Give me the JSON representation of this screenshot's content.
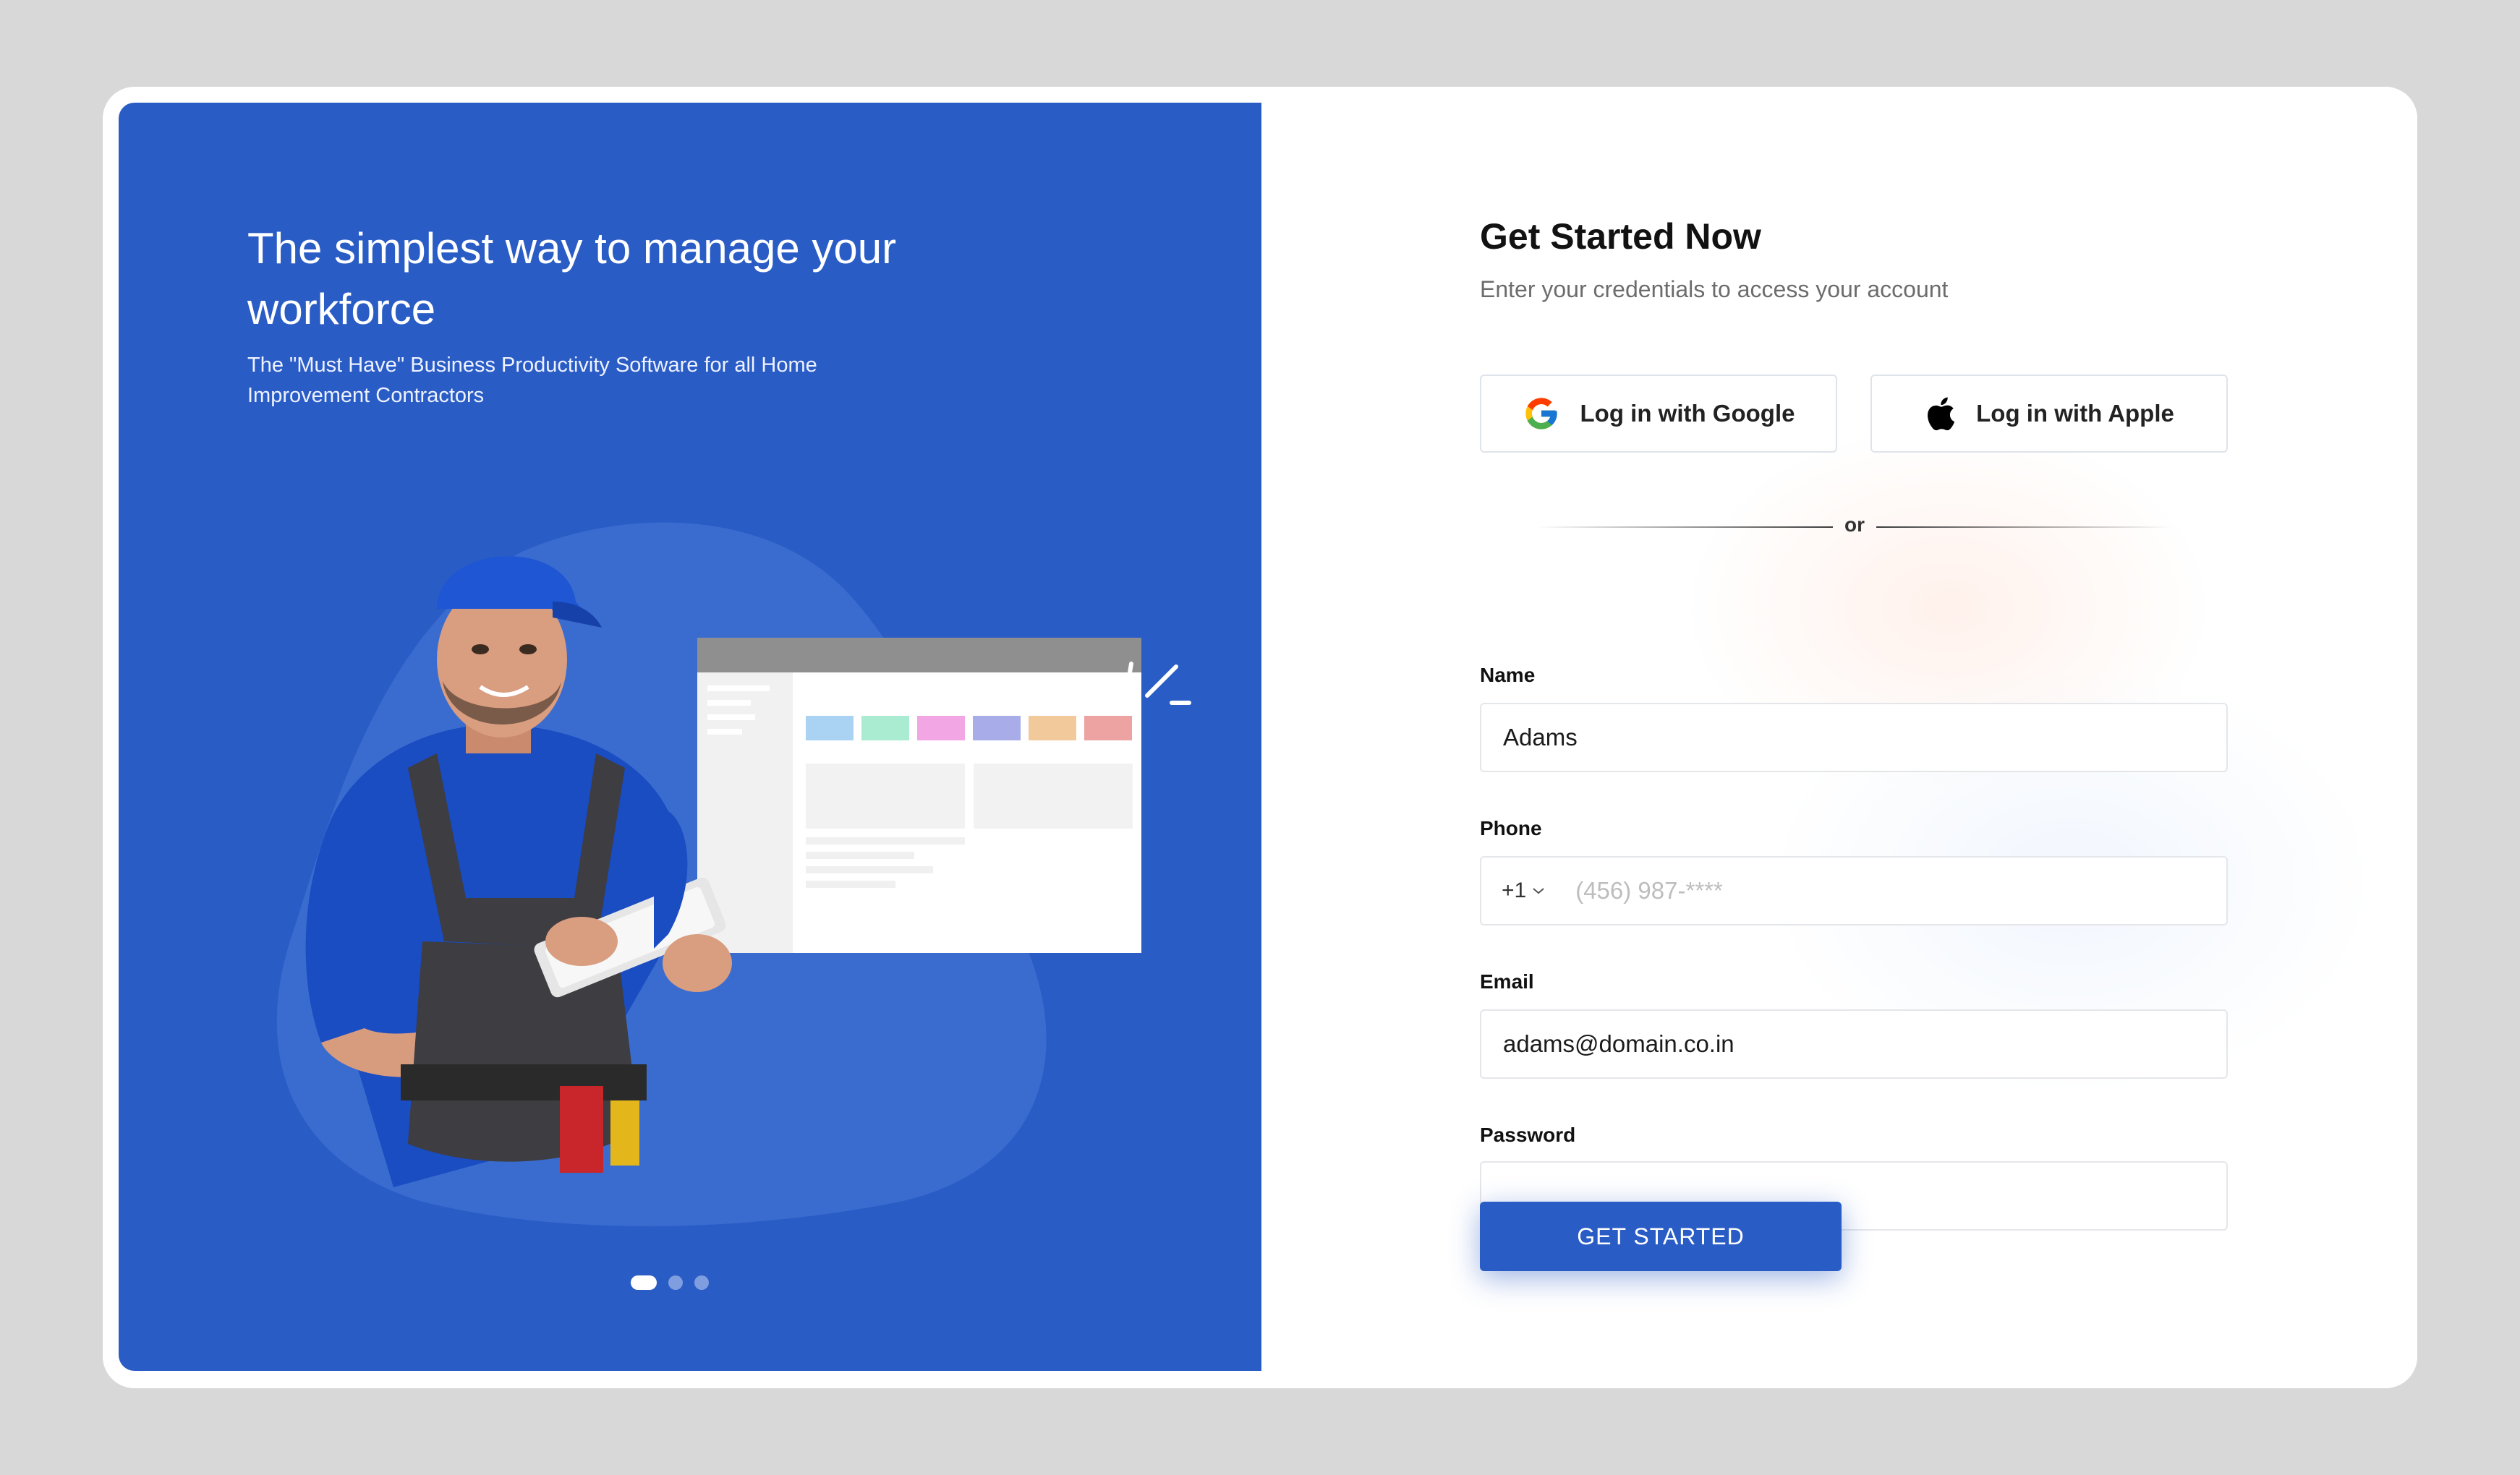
{
  "hero": {
    "headline": "The simplest way to manage your workforce",
    "subline": "The \"Must Have\" Business Productivity Software for all Home Improvement Contractors",
    "slides": 3,
    "active_slide": 0
  },
  "form": {
    "title": "Get Started Now",
    "subtitle": "Enter your credentials to access your account",
    "google_label": "Log in with Google",
    "apple_label": "Log in with Apple",
    "divider_text": "or",
    "name_label": "Name",
    "name_value": "Adams",
    "phone_label": "Phone",
    "phone_code": "+1",
    "phone_placeholder": "(456) 987-****",
    "email_label": "Email",
    "email_value": "adams@domain.co.in",
    "password_label": "Password",
    "password_value": "",
    "submit_label": "GET STARTED"
  },
  "colors": {
    "brand_blue": "#2a5cc6",
    "background": "#d8d8d8"
  }
}
